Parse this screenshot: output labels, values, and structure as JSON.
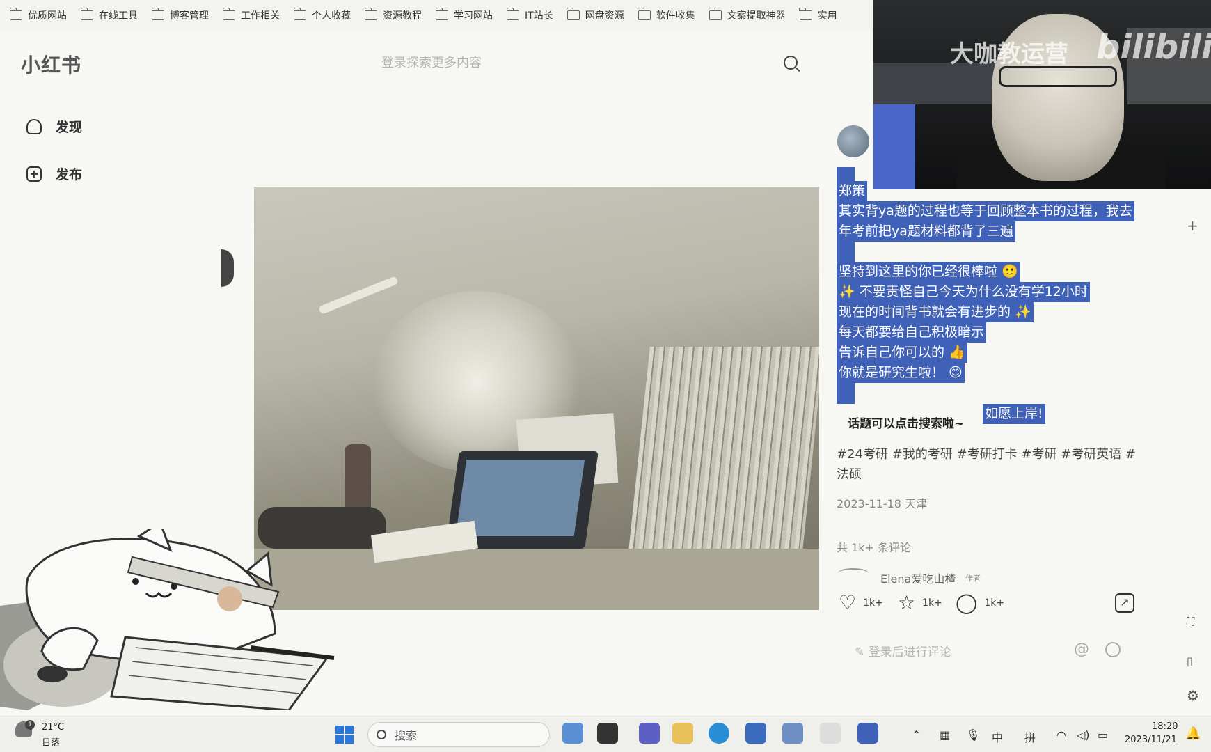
{
  "bookmarks": [
    {
      "label": "优质网站"
    },
    {
      "label": "在线工具"
    },
    {
      "label": "博客管理"
    },
    {
      "label": "工作相关"
    },
    {
      "label": "个人收藏"
    },
    {
      "label": "资源教程"
    },
    {
      "label": "学习网站"
    },
    {
      "label": "IT站长"
    },
    {
      "label": "网盘资源"
    },
    {
      "label": "软件收集"
    },
    {
      "label": "文案提取神器"
    },
    {
      "label": "实用"
    }
  ],
  "header": {
    "logo": "小红书",
    "search_placeholder": "登录探索更多内容"
  },
  "sidebar": {
    "items": [
      {
        "label": "发现",
        "icon": "home-icon"
      },
      {
        "label": "发布",
        "icon": "plus-square-icon"
      }
    ]
  },
  "note": {
    "lines": [
      "郑策",
      "其实背ya题的过程也等于回顾整本书的过程，我去",
      "年考前把ya题材料都背了三遍",
      "坚持到这里的你已经很棒啦 🙂",
      "✨ 不要责怪自己今天为什么没有学12小时",
      "现在的时间背书就会有进步的 ✨",
      "每天都要给自己积极暗示",
      "告诉自己你可以的 👍",
      "你就是研究生啦！ 😊",
      "如愿上岸!"
    ],
    "topic_hint": "话题可以点击搜索啦~",
    "tags": "#24考研  #我的考研  #考研打卡  #考研  #考研英语  #法硕",
    "date": "2023-11-18 天津",
    "comment_count": "共 1k+ 条评论",
    "commenter": "Elena爱吃山楂",
    "author_tag": "作者",
    "actions": {
      "likes": "1k+",
      "collects": "1k+",
      "comments": "1k+"
    },
    "comment_placeholder": "登录后进行评论"
  },
  "webcam": {
    "watermark_text": "大咖教运营",
    "watermark_logo": "bilibili"
  },
  "taskbar": {
    "temperature": "21°C",
    "weather": "日落",
    "weather_badge": "1",
    "search_label": "搜索",
    "ime_lang": "中",
    "ime_mode": "拼",
    "time": "18:20",
    "date": "2023/11/21"
  }
}
